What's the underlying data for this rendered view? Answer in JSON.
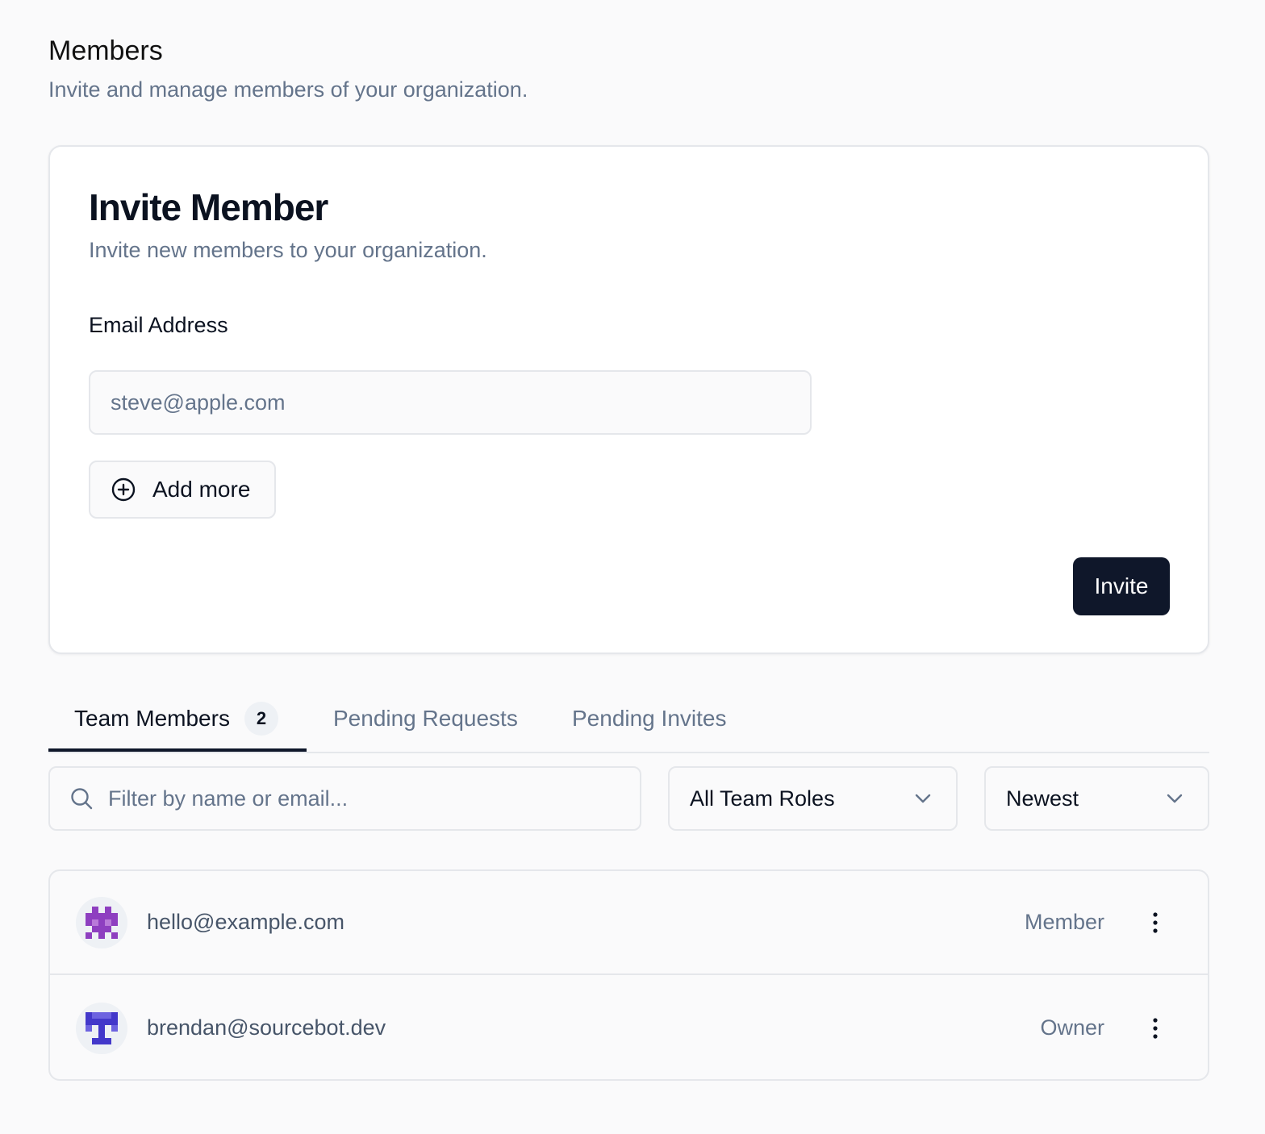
{
  "header": {
    "title": "Members",
    "subtitle": "Invite and manage members of your organization."
  },
  "invite_card": {
    "title": "Invite Member",
    "subtitle": "Invite new members to your organization.",
    "email_label": "Email Address",
    "email_placeholder": "steve@apple.com",
    "add_more_label": "Add more",
    "add_more_icon": "plus-circle-icon",
    "invite_label": "Invite"
  },
  "tabs": [
    {
      "label": "Team Members",
      "count": "2",
      "active": true
    },
    {
      "label": "Pending Requests",
      "active": false
    },
    {
      "label": "Pending Invites",
      "active": false
    }
  ],
  "filters": {
    "search_icon": "search-icon",
    "search_placeholder": "Filter by name or email...",
    "role_filter": {
      "selected": "All Team Roles",
      "icon": "chevron-down-icon"
    },
    "sort": {
      "selected": "Newest",
      "icon": "chevron-down-icon"
    }
  },
  "members": [
    {
      "email": "hello@example.com",
      "role": "Member",
      "avatar_color": "#8e3fc0",
      "menu_icon": "more-vertical-icon"
    },
    {
      "email": "brendan@sourcebot.dev",
      "role": "Owner",
      "avatar_color": "#4338ca",
      "menu_icon": "more-vertical-icon"
    }
  ],
  "colors": {
    "primary": "#0f172a",
    "muted_text": "#64748b",
    "border": "#e5e7eb",
    "background": "#fafafb"
  }
}
